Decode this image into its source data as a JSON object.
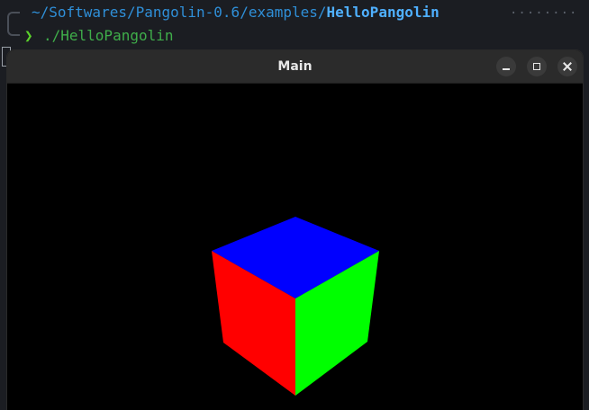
{
  "terminal": {
    "path_prefix": "~/Softwares/Pangolin-0.6/examples/",
    "path_current": "HelloPangolin",
    "trail_dots": "········",
    "prompt_symbol": "❯",
    "command": "./HelloPangolin"
  },
  "window": {
    "title": "Main",
    "controls": {
      "minimize_icon": "minimize-icon",
      "maximize_icon": "maximize-icon",
      "close_icon": "close-icon"
    }
  },
  "scene": {
    "background": "#000000",
    "cube_faces": {
      "top": "#0000ff",
      "left": "#ff0000",
      "right": "#00ff00"
    }
  }
}
